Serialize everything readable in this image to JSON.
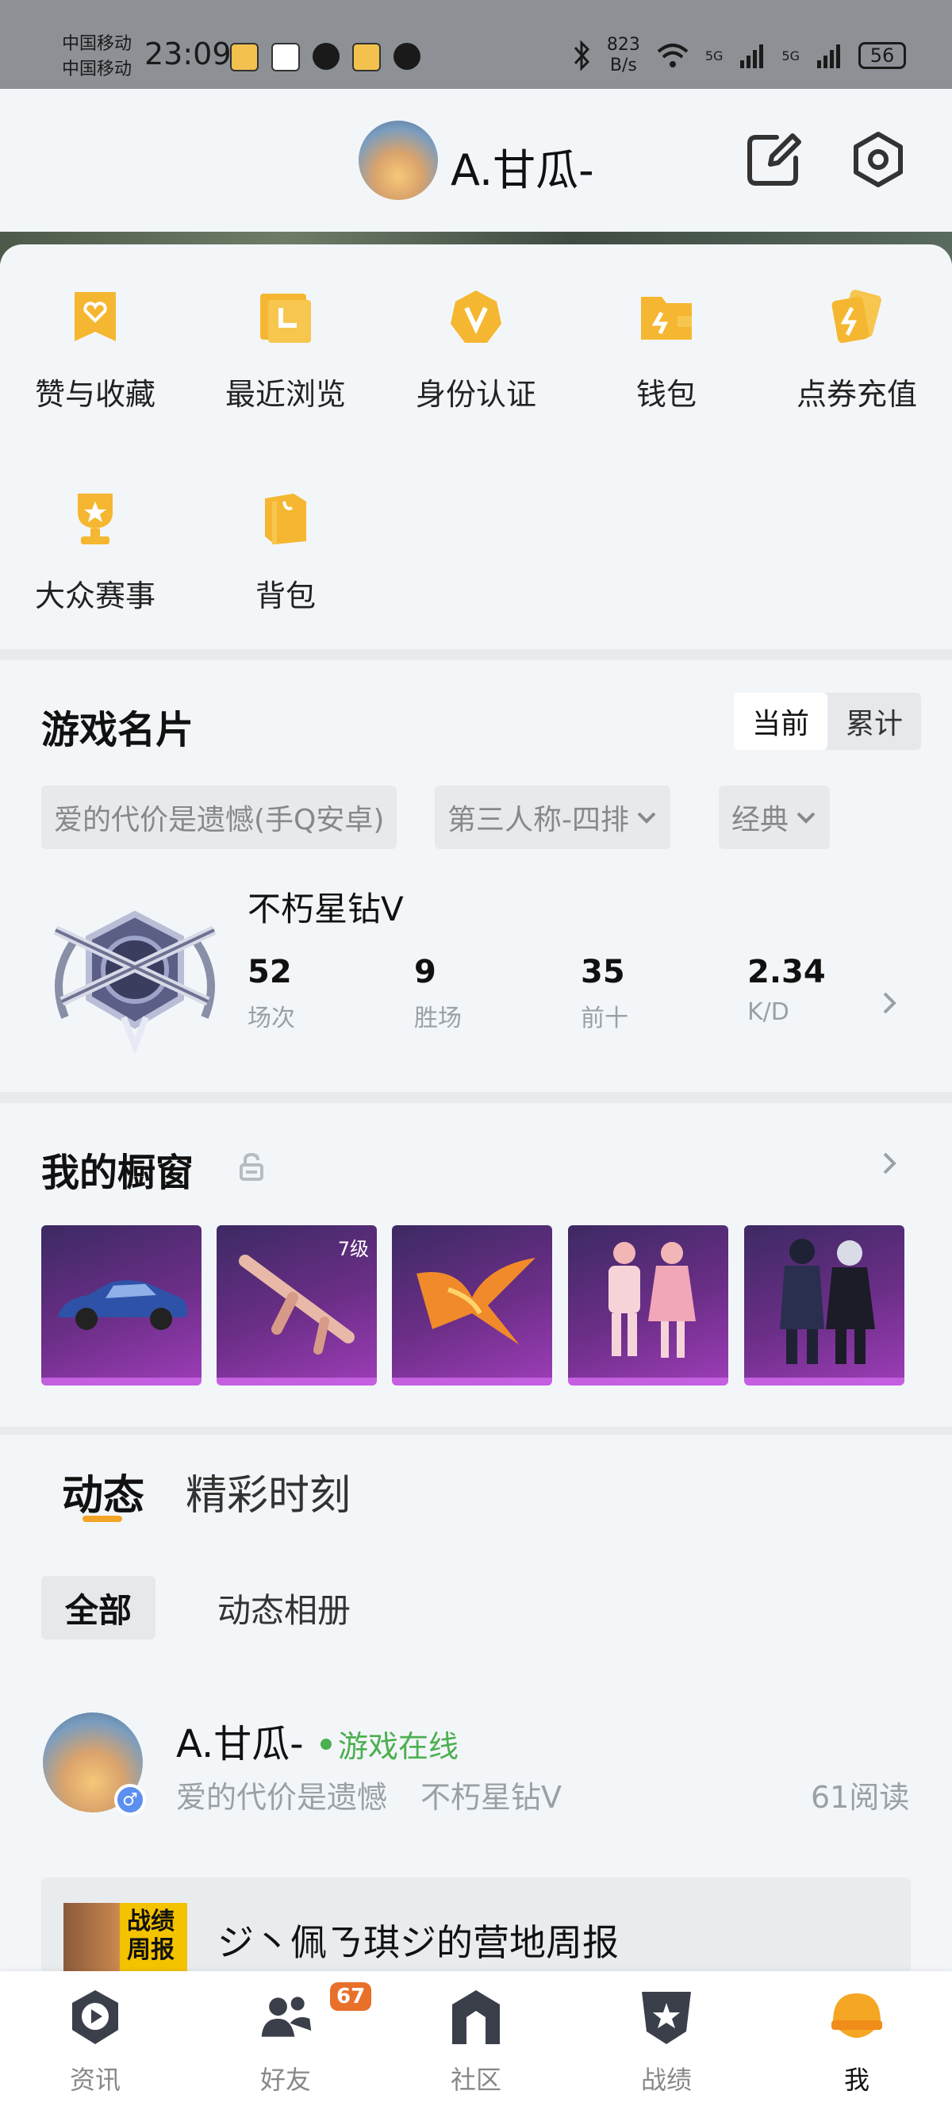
{
  "status_bar": {
    "carrier_1": "中国移动",
    "carrier_2": "中国移动",
    "time": "23:09",
    "net_speed_value": "823",
    "net_speed_unit": "B/s",
    "signal_1": "5G",
    "signal_2": "5G",
    "battery": "56"
  },
  "header": {
    "username": "A.甘瓜-",
    "edit_icon": "edit-icon",
    "settings_icon": "hexagon-settings-icon"
  },
  "quick_menu": [
    {
      "label": "赞与收藏",
      "icon": "bookmark-heart-icon"
    },
    {
      "label": "最近浏览",
      "icon": "recent-browse-icon"
    },
    {
      "label": "身份认证",
      "icon": "verified-badge-icon"
    },
    {
      "label": "钱包",
      "icon": "wallet-icon"
    },
    {
      "label": "点券充值",
      "icon": "coupon-cards-icon"
    },
    {
      "label": "大众赛事",
      "icon": "trophy-icon"
    },
    {
      "label": "背包",
      "icon": "backpack-icon"
    }
  ],
  "game_card": {
    "title": "游戏名片",
    "toggle": [
      "当前",
      "累计"
    ],
    "filters": [
      "爱的代价是遗憾(手Q安卓)",
      "第三人称-四排",
      "经典"
    ],
    "rank_name": "不朽星钻V",
    "stats": [
      {
        "value": "52",
        "label": "场次"
      },
      {
        "value": "9",
        "label": "胜场"
      },
      {
        "value": "35",
        "label": "前十"
      },
      {
        "value": "2.34",
        "label": "K/D"
      }
    ]
  },
  "showcase": {
    "title": "我的橱窗",
    "items": [
      {
        "name": "blue-sports-car"
      },
      {
        "name": "pink-rifle",
        "level": "7级"
      },
      {
        "name": "phoenix-glider"
      },
      {
        "name": "pink-couple-outfits"
      },
      {
        "name": "dark-armor-outfits"
      }
    ]
  },
  "feed": {
    "tabs": [
      "动态",
      "精彩时刻"
    ],
    "subtabs": [
      "全部",
      "动态相册"
    ],
    "post": {
      "author": "A.甘瓜-",
      "online_status": "游戏在线",
      "game_id": "爱的代价是遗憾",
      "rank": "不朽星钻V",
      "reads": "61阅读",
      "gender_symbol": "♂"
    },
    "report": {
      "thumb_text": "战绩周报",
      "title": "ジ丶佩ㄋ琪ジ的营地周报"
    }
  },
  "bottom_nav": [
    {
      "label": "资讯",
      "icon": "news-play-icon"
    },
    {
      "label": "好友",
      "icon": "friends-icon",
      "badge": "67"
    },
    {
      "label": "社区",
      "icon": "community-house-icon"
    },
    {
      "label": "战绩",
      "icon": "record-shield-icon"
    },
    {
      "label": "我",
      "icon": "me-helmet-icon",
      "active": true
    }
  ]
}
